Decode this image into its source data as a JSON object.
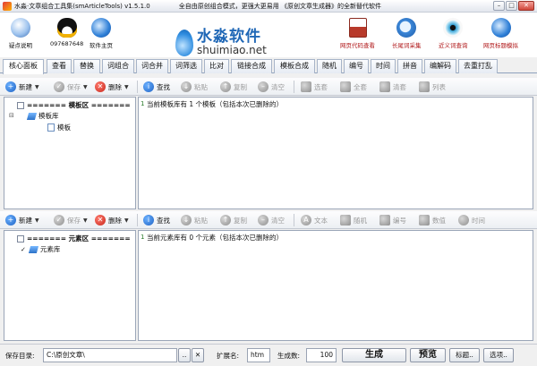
{
  "window": {
    "title": "水淼·文章组合工具集(smArticleTools) v1.5.1.0",
    "slogan": "全自由原创组合模式，更强大更易用 《原创文章生成器》的全新替代软件",
    "minimize": "–",
    "maximize": "□",
    "close": "✕"
  },
  "banner": {
    "left_icons": [
      {
        "label": "疑点说明",
        "icon": "help-icon"
      },
      {
        "label": "097687648",
        "icon": "qq-penguin-icon"
      },
      {
        "label": "软件主页",
        "icon": "ie-globe-icon"
      }
    ],
    "logo_cn": "水淼软件",
    "logo_en": "shuimiao.net",
    "right_icons": [
      {
        "label": "网页代码查看",
        "icon": "html-code-icon"
      },
      {
        "label": "长尾词采集",
        "icon": "magnifier-icon"
      },
      {
        "label": "近义词查询",
        "icon": "eye-icon"
      },
      {
        "label": "网页标题模拟",
        "icon": "globe-icon"
      }
    ]
  },
  "tabs": [
    "核心面板",
    "查看",
    "替换",
    "词组合",
    "词合并",
    "词筛选",
    "比对",
    "链接合成",
    "模板合成",
    "随机",
    "编号",
    "时间",
    "拼音",
    "编解码",
    "去重打乱"
  ],
  "active_tab": 0,
  "toolbar1": {
    "new": "新建",
    "save": "保存",
    "delete": "删除",
    "find": "查找",
    "paste": "粘贴",
    "copy": "复制",
    "clear": "清空",
    "select": "选套",
    "select_all": "全套",
    "clear_sel": "清套",
    "list": "列表"
  },
  "toolbar2": {
    "new": "新建",
    "save": "保存",
    "delete": "删除",
    "find": "查找",
    "paste": "粘贴",
    "copy": "复制",
    "clear": "清空",
    "text": "文本",
    "random": "随机",
    "number": "编号",
    "value": "数值",
    "time": "时间"
  },
  "template_area": {
    "header": "======= 模板区 =======",
    "expander": "⊟",
    "root": "模板库",
    "child": "模板"
  },
  "element_area": {
    "header": "======= 元素区 =======",
    "root": "元素库",
    "check": "✓"
  },
  "editor1": {
    "line": "1",
    "text": "当前模板库有 1 个模板（包括本次已删除的）"
  },
  "editor2": {
    "line": "1",
    "text": "当前元素库有 0 个元素（包括本次已删除的）"
  },
  "status": {
    "save_dir_label": "保存目录:",
    "save_dir_value": "C:\\原创文章\\",
    "browse": "..",
    "clear": "✕",
    "ext_label": "扩展名:",
    "ext_value": "htm",
    "count_label": "生成数:",
    "count_value": "100",
    "generate": "生成",
    "preview": "预览",
    "title_btn": "标题..",
    "options_btn": "选项.."
  },
  "colors": {
    "accent": "#1f67b6",
    "delete_red": "#c7261a",
    "line_number_green": "#2a7a2a"
  }
}
